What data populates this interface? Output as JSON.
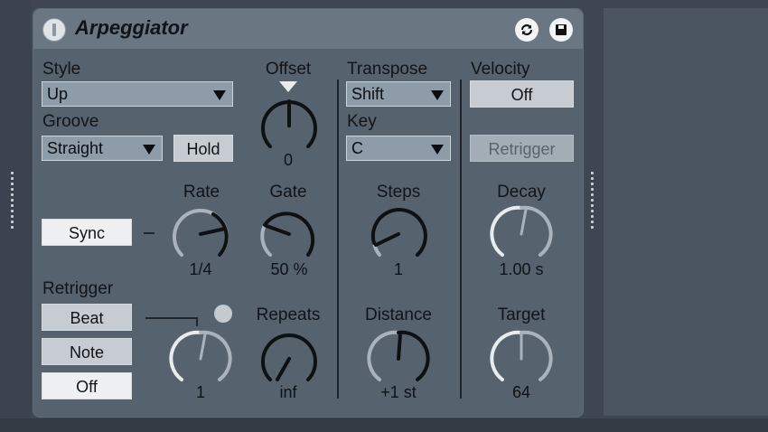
{
  "device": {
    "title": "Arpeggiator"
  },
  "style": {
    "label": "Style",
    "value": "Up"
  },
  "groove": {
    "label": "Groove",
    "value": "Straight"
  },
  "hold": {
    "label": "Hold"
  },
  "offset": {
    "label": "Offset",
    "value": "0"
  },
  "transpose": {
    "label": "Transpose",
    "value": "Shift"
  },
  "key": {
    "label": "Key",
    "value": "C"
  },
  "velocity": {
    "label": "Velocity",
    "toggle": "Off",
    "retrigger": "Retrigger"
  },
  "rate": {
    "label": "Rate",
    "value": "1/4"
  },
  "gate": {
    "label": "Gate",
    "value": "50 %"
  },
  "sync": {
    "label": "Sync"
  },
  "steps": {
    "label": "Steps",
    "value": "1"
  },
  "decay": {
    "label": "Decay",
    "value": "1.00 s"
  },
  "retrigger": {
    "label": "Retrigger",
    "options": [
      "Beat",
      "Note",
      "Off"
    ],
    "selected": "Off"
  },
  "retrigger_amount": {
    "value": "1"
  },
  "repeats": {
    "label": "Repeats",
    "value": "inf"
  },
  "distance": {
    "label": "Distance",
    "value": "+1 st"
  },
  "target": {
    "label": "Target",
    "value": "64"
  },
  "colors": {
    "panel": "#56626e",
    "titlebar": "#6a7682",
    "dropdown": "#8e9ba8",
    "button": "#c6ccd1"
  }
}
